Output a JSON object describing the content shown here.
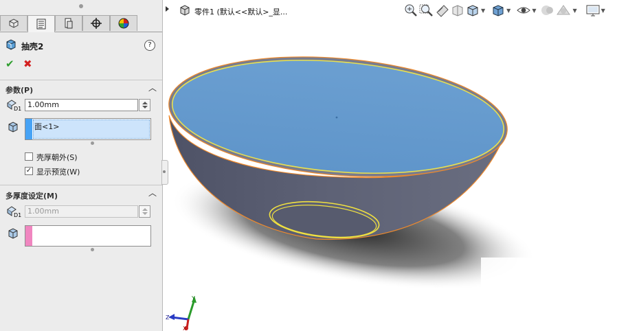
{
  "header": {
    "part_title": "零件1  (默认<<默认>_显..."
  },
  "panel": {
    "feature_icon": "shell-feature-icon",
    "feature_title": "抽壳2",
    "help_label": "?",
    "ok_label": "✔",
    "cancel_label": "✖",
    "tabs": [
      "feature-manager-icon",
      "property-manager-icon",
      "configuration-manager-icon",
      "dimxpert-icon",
      "display-manager-icon"
    ],
    "parameters": {
      "title": "参数(P)",
      "thickness_value": "1.00mm",
      "faces_item": "面<1>",
      "faces_color": "#47a3f5",
      "shell_outward_label": "壳厚朝外(S)",
      "shell_outward_checked": false,
      "show_preview_label": "显示预览(W)",
      "show_preview_checked": true
    },
    "multi_thickness": {
      "title": "多厚度设定(M)",
      "thickness_value": "1.00mm",
      "faces_color": "#f086c0"
    }
  },
  "viewport": {
    "toolbar_icons": [
      "zoom-to-fit-icon",
      "zoom-to-area-icon",
      "previous-view-icon",
      "section-view-icon",
      "view-orientation-icon",
      "display-style-icon",
      "hide-show-items-icon",
      "edit-appearance-icon",
      "apply-scene-icon",
      "view-settings-icon"
    ],
    "triad_labels": {
      "x": "X",
      "y": "Y",
      "z": "Z"
    },
    "colors": {
      "inner_face": "#6699cc",
      "outer_body": "#5b5f73",
      "edge_highlight": "#e8e050",
      "edge_orange": "#f08a2c"
    }
  }
}
